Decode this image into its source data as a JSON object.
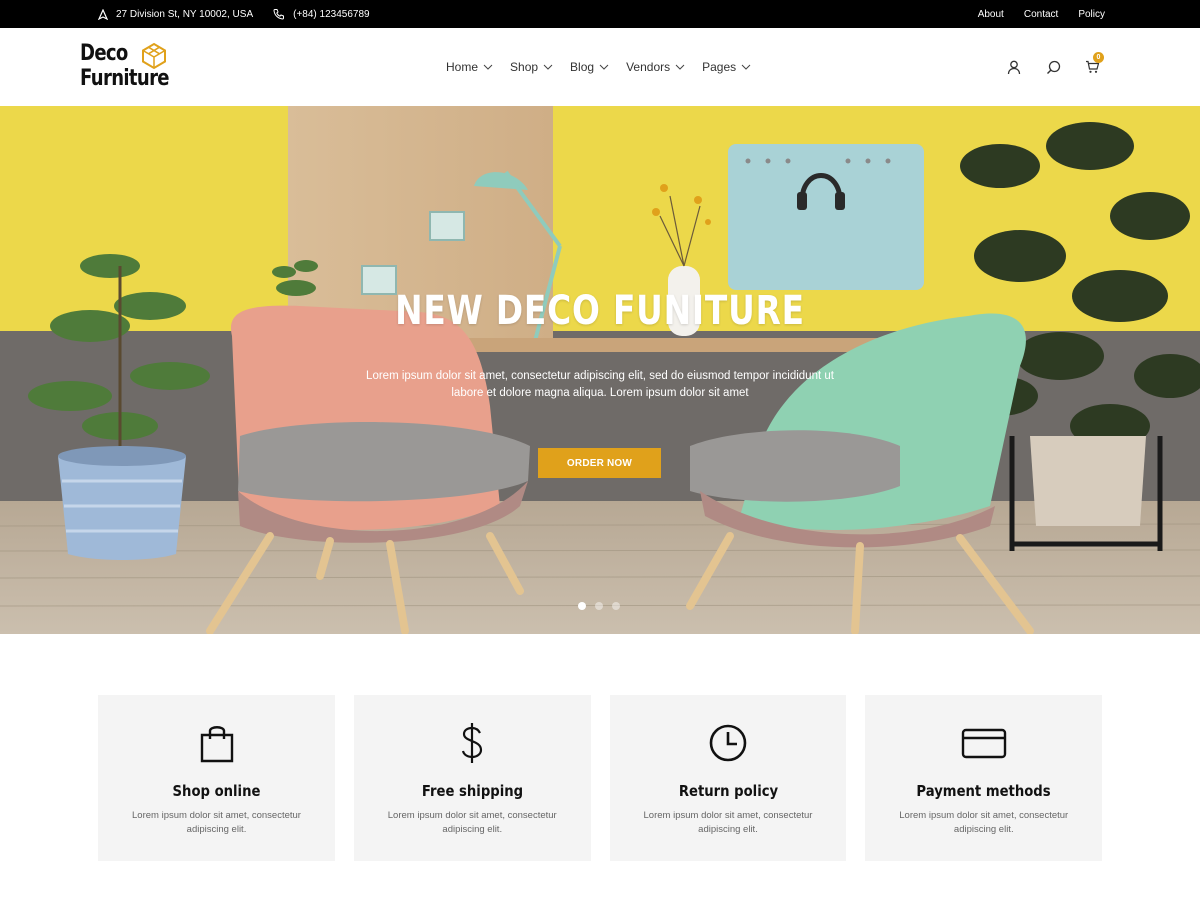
{
  "topbar": {
    "address": "27 Division St, NY 10002, USA",
    "phone": "(+84) 123456789",
    "links": [
      "About",
      "Contact",
      "Policy"
    ]
  },
  "logo": {
    "line1": "Deco",
    "line2": "Furniture"
  },
  "nav": {
    "items": [
      "Home",
      "Shop",
      "Blog",
      "Vendors",
      "Pages"
    ]
  },
  "header": {
    "cart_count": "0"
  },
  "hero": {
    "title": "NEW DECO FUNITURE",
    "subtitle": "Lorem ipsum dolor sit amet, consectetur adipiscing elit, sed do eiusmod tempor incididunt ut labore et dolore magna aliqua. Lorem ipsum dolor sit amet",
    "button": "ORDER NOW",
    "slides": 3,
    "active_slide": 1
  },
  "features": [
    {
      "icon": "shopping-bag-icon",
      "title": "Shop online",
      "desc": "Lorem ipsum dolor sit amet, consectetur adipiscing elit."
    },
    {
      "icon": "dollar-icon",
      "title": "Free shipping",
      "desc": "Lorem ipsum dolor sit amet, consectetur adipiscing elit."
    },
    {
      "icon": "clock-icon",
      "title": "Return policy",
      "desc": "Lorem ipsum dolor sit amet, consectetur adipiscing elit."
    },
    {
      "icon": "credit-card-icon",
      "title": "Payment methods",
      "desc": "Lorem ipsum dolor sit amet, consectetur adipiscing elit."
    }
  ],
  "colors": {
    "accent": "#e0a11b",
    "topbar": "#000000",
    "feature_bg": "#f4f4f4"
  }
}
